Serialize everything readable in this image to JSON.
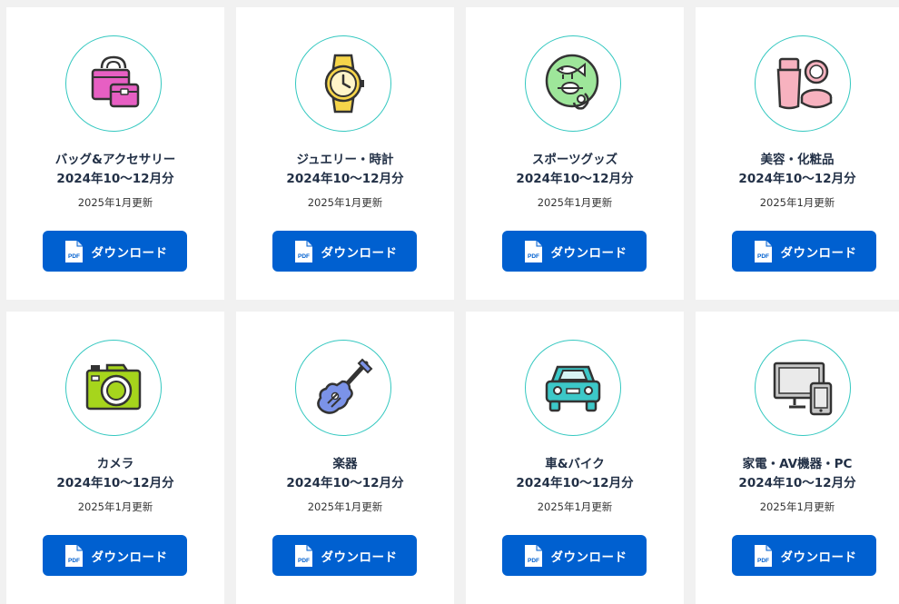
{
  "colors": {
    "background": "#f1f1f1",
    "card": "#ffffff",
    "button": "#0060d0",
    "circle_border": "#34c8c0",
    "text": "#223046"
  },
  "cards": [
    {
      "title": "バッグ&アクセサリー",
      "period": "2024年10〜12月分",
      "updated": "2025年1月更新",
      "button_label": "ダウンロード",
      "pdf_text": "PDF",
      "icon": "handbag-icon"
    },
    {
      "title": "ジュエリー・時計",
      "period": "2024年10〜12月分",
      "updated": "2025年1月更新",
      "button_label": "ダウンロード",
      "pdf_text": "PDF",
      "icon": "wristwatch-icon"
    },
    {
      "title": "スポーツグッズ",
      "period": "2024年10〜12月分",
      "updated": "2025年1月更新",
      "button_label": "ダウンロード",
      "pdf_text": "PDF",
      "icon": "fishing-lure-icon"
    },
    {
      "title": "美容・化粧品",
      "period": "2024年10〜12月分",
      "updated": "2025年1月更新",
      "button_label": "ダウンロード",
      "pdf_text": "PDF",
      "icon": "cosmetics-icon"
    },
    {
      "title": "カメラ",
      "period": "2024年10〜12月分",
      "updated": "2025年1月更新",
      "button_label": "ダウンロード",
      "pdf_text": "PDF",
      "icon": "camera-icon"
    },
    {
      "title": "楽器",
      "period": "2024年10〜12月分",
      "updated": "2025年1月更新",
      "button_label": "ダウンロード",
      "pdf_text": "PDF",
      "icon": "guitar-icon"
    },
    {
      "title": "車&バイク",
      "period": "2024年10〜12月分",
      "updated": "2025年1月更新",
      "button_label": "ダウンロード",
      "pdf_text": "PDF",
      "icon": "car-icon"
    },
    {
      "title": "家電・AV機器・PC",
      "period": "2024年10〜12月分",
      "updated": "2025年1月更新",
      "button_label": "ダウンロード",
      "pdf_text": "PDF",
      "icon": "monitor-tablet-icon"
    }
  ]
}
